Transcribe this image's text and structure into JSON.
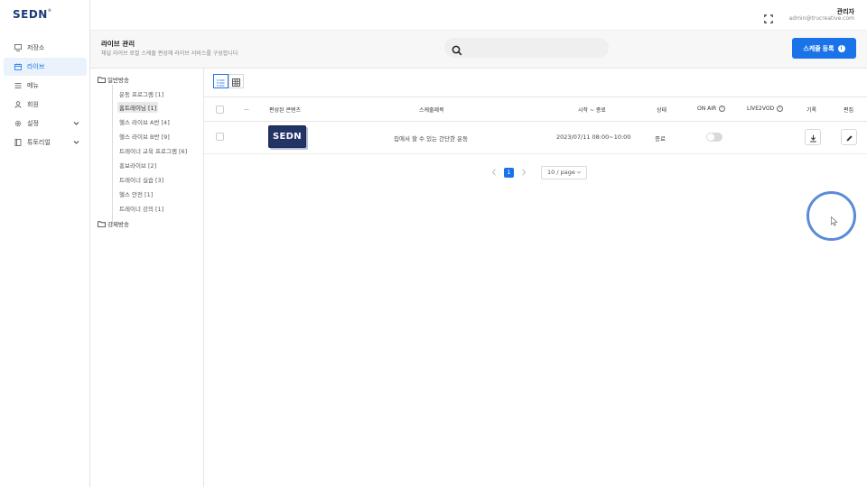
{
  "brand": {
    "logo": "SEDN",
    "mark": "®"
  },
  "sidebar": {
    "items": [
      {
        "label": "저장소",
        "icon": "monitor-icon"
      },
      {
        "label": "라이브",
        "icon": "calendar-icon",
        "active": true
      },
      {
        "label": "메뉴",
        "icon": "menu-icon"
      },
      {
        "label": "회원",
        "icon": "user-icon"
      },
      {
        "label": "설정",
        "icon": "gear-icon",
        "expandable": true
      },
      {
        "label": "튜토리얼",
        "icon": "book-icon",
        "expandable": true
      }
    ]
  },
  "header": {
    "user_name": "관리자",
    "user_email": "admin@trucreative.com"
  },
  "page": {
    "title": "라이브 관리",
    "subtitle": "채널 라이브 로컬 스케줄 편성해 라이브 서비스를 구성합니다",
    "search_placeholder": "",
    "register_button": "스케줄 등록"
  },
  "tree": {
    "roots": [
      {
        "label": "일반방송"
      },
      {
        "label": "강제방송"
      }
    ],
    "children": [
      {
        "label": "운동 프로그램 [1]"
      },
      {
        "label": "홈트레이닝 [1]",
        "selected": true
      },
      {
        "label": "헬스 라이브 A반 [4]"
      },
      {
        "label": "헬스 라이브 B반 [9]"
      },
      {
        "label": "트레이너 교육 프로그램 [6]"
      },
      {
        "label": "홍보라이브 [2]"
      },
      {
        "label": "트레이너 실습 [3]"
      },
      {
        "label": "헬스 안전 [1]"
      },
      {
        "label": "트레이너 강의 [1]"
      }
    ]
  },
  "table": {
    "headers": {
      "more": "...",
      "content": "편성된 콘텐츠",
      "name": "스케줄제목",
      "period": "시작 ~ 종료",
      "status": "상태",
      "onair": "ON AIR",
      "live2vod": "LIVE2VOD",
      "record": "기록",
      "edit": "편집"
    },
    "rows": [
      {
        "thumb_text": "SEDN",
        "name": "집에서 할 수 있는 간단한 운동",
        "period": "2023/07/11 08:00~10:00",
        "status": "종료",
        "onair": false
      }
    ]
  },
  "pagination": {
    "current": "1",
    "page_size": "10 / page"
  },
  "colors": {
    "primary": "#1a73e8",
    "brand": "#1b3a7a"
  }
}
